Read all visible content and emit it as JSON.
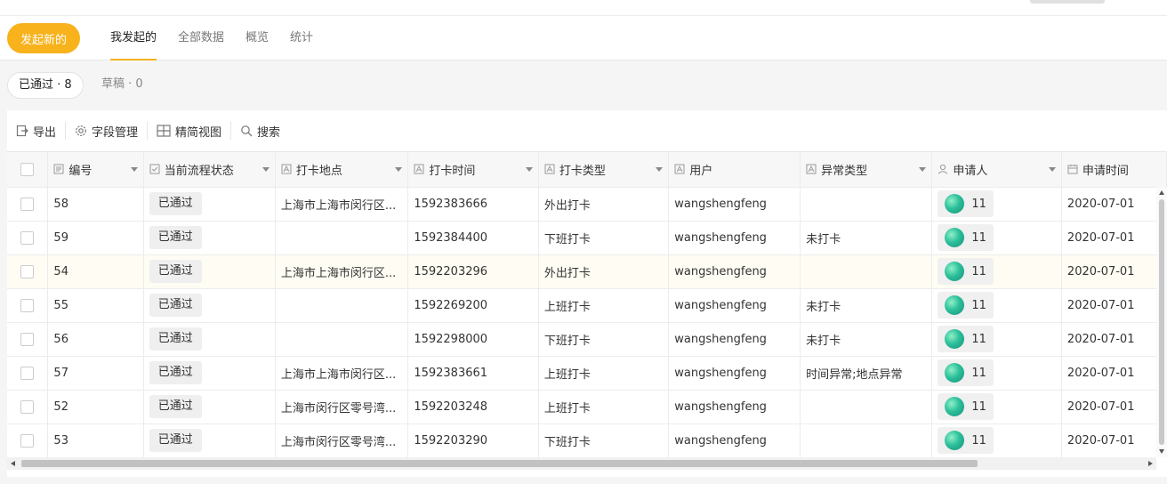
{
  "header": {
    "new_button": "发起新的",
    "tabs": [
      {
        "label": "我发起的",
        "active": true
      },
      {
        "label": "全部数据",
        "active": false
      },
      {
        "label": "概览",
        "active": false
      },
      {
        "label": "统计",
        "active": false
      }
    ]
  },
  "subtabs": {
    "approved": "已通过 · 8",
    "draft": "草稿 · 0"
  },
  "toolbar": {
    "export": "导出",
    "field_manage": "字段管理",
    "simple_view": "精简视图",
    "search": "搜索"
  },
  "table": {
    "columns": [
      "编号",
      "当前流程状态",
      "打卡地点",
      "打卡时间",
      "打卡类型",
      "用户",
      "异常类型",
      "申请人",
      "申请时间"
    ],
    "rows": [
      {
        "id": "58",
        "status": "已通过",
        "location": "上海市上海市闵行区...",
        "time": "1592383666",
        "type": "外出打卡",
        "user": "wangshengfeng",
        "exception": "",
        "applicant": "11",
        "apply_time": "2020-07-01"
      },
      {
        "id": "59",
        "status": "已通过",
        "location": "",
        "time": "1592384400",
        "type": "下班打卡",
        "user": "wangshengfeng",
        "exception": "未打卡",
        "applicant": "11",
        "apply_time": "2020-07-01"
      },
      {
        "id": "54",
        "status": "已通过",
        "location": "上海市上海市闵行区...",
        "time": "1592203296",
        "type": "外出打卡",
        "user": "wangshengfeng",
        "exception": "",
        "applicant": "11",
        "apply_time": "2020-07-01"
      },
      {
        "id": "55",
        "status": "已通过",
        "location": "",
        "time": "1592269200",
        "type": "上班打卡",
        "user": "wangshengfeng",
        "exception": "未打卡",
        "applicant": "11",
        "apply_time": "2020-07-01"
      },
      {
        "id": "56",
        "status": "已通过",
        "location": "",
        "time": "1592298000",
        "type": "下班打卡",
        "user": "wangshengfeng",
        "exception": "未打卡",
        "applicant": "11",
        "apply_time": "2020-07-01"
      },
      {
        "id": "57",
        "status": "已通过",
        "location": "上海市上海市闵行区...",
        "time": "1592383661",
        "type": "上班打卡",
        "user": "wangshengfeng",
        "exception": "时间异常;地点异常",
        "applicant": "11",
        "apply_time": "2020-07-01"
      },
      {
        "id": "52",
        "status": "已通过",
        "location": "上海市闵行区零号湾...",
        "time": "1592203248",
        "type": "上班打卡",
        "user": "wangshengfeng",
        "exception": "",
        "applicant": "11",
        "apply_time": "2020-07-01"
      },
      {
        "id": "53",
        "status": "已通过",
        "location": "上海市闵行区零号湾...",
        "time": "1592203290",
        "type": "下班打卡",
        "user": "wangshengfeng",
        "exception": "",
        "applicant": "11",
        "apply_time": "2020-07-01"
      }
    ]
  },
  "colors": {
    "accent": "#f7b21c"
  },
  "icons": {
    "export": "export-icon",
    "field_manage": "gear-icon",
    "simple_view": "grid-icon",
    "search": "search-icon"
  }
}
